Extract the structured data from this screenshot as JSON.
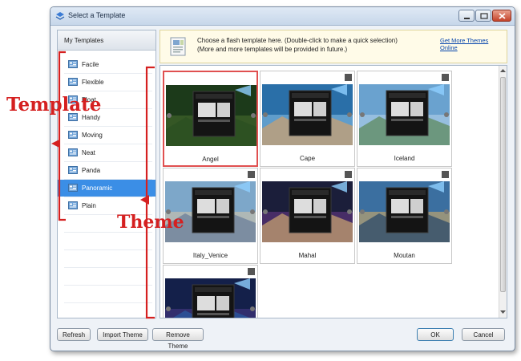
{
  "window": {
    "title": "Select a Template"
  },
  "left_panel": {
    "header": "My Templates",
    "items": [
      {
        "label": "Facile"
      },
      {
        "label": "Flexible"
      },
      {
        "label": "Float"
      },
      {
        "label": "Handy"
      },
      {
        "label": "Moving"
      },
      {
        "label": "Neat"
      },
      {
        "label": "Panda"
      },
      {
        "label": "Panoramic",
        "selected": true
      },
      {
        "label": "Plain"
      }
    ]
  },
  "info": {
    "line1": "Choose a flash template here. (Double-click to make a quick selection)",
    "line2": "(More and more templates will be provided in future.)",
    "link": "Get More Themes Online"
  },
  "themes": [
    {
      "name": "Angel",
      "selected": true
    },
    {
      "name": "Cape"
    },
    {
      "name": "Iceland"
    },
    {
      "name": "Italy_Venice"
    },
    {
      "name": "Mahal"
    },
    {
      "name": "Moutan"
    },
    {
      "name": ""
    }
  ],
  "buttons": {
    "refresh": "Refresh",
    "import": "Import Theme",
    "remove": "Remove Theme",
    "ok": "OK",
    "cancel": "Cancel"
  },
  "annotations": {
    "template": "Template",
    "theme": "Theme",
    "color": "#d52020"
  },
  "colors": {
    "selection_blue": "#3b8ee6",
    "highlight_red": "#e05050",
    "link_blue": "#0645ad"
  }
}
